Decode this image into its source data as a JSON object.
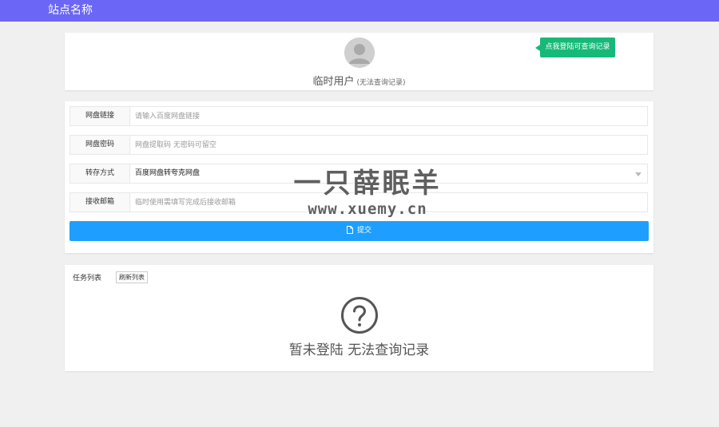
{
  "header": {
    "site_name": "站点名称"
  },
  "user": {
    "name": "临时用户",
    "note": "(无法查询记录)",
    "login_button": "点我登陆可查询记录"
  },
  "form": {
    "link": {
      "label": "网盘链接",
      "placeholder": "请输入百度网盘链接",
      "value": ""
    },
    "password": {
      "label": "网盘密码",
      "placeholder": "网盘提取码 无密码可留空",
      "value": ""
    },
    "method": {
      "label": "转存方式",
      "selected": "百度网盘转夸克网盘"
    },
    "email": {
      "label": "接收邮箱",
      "placeholder": "临时使用需填写完成后接收邮箱",
      "value": ""
    },
    "submit_label": "提交"
  },
  "tasks": {
    "title": "任务列表",
    "refresh_button": "刷新列表",
    "empty_message": "暂未登陆 无法查询记录"
  },
  "watermark": {
    "title": "一只薛眠羊",
    "url": "www.xuemy.cn"
  },
  "colors": {
    "header": "#6b66f5",
    "login_button": "#17b978",
    "submit_button": "#1e9fff"
  }
}
